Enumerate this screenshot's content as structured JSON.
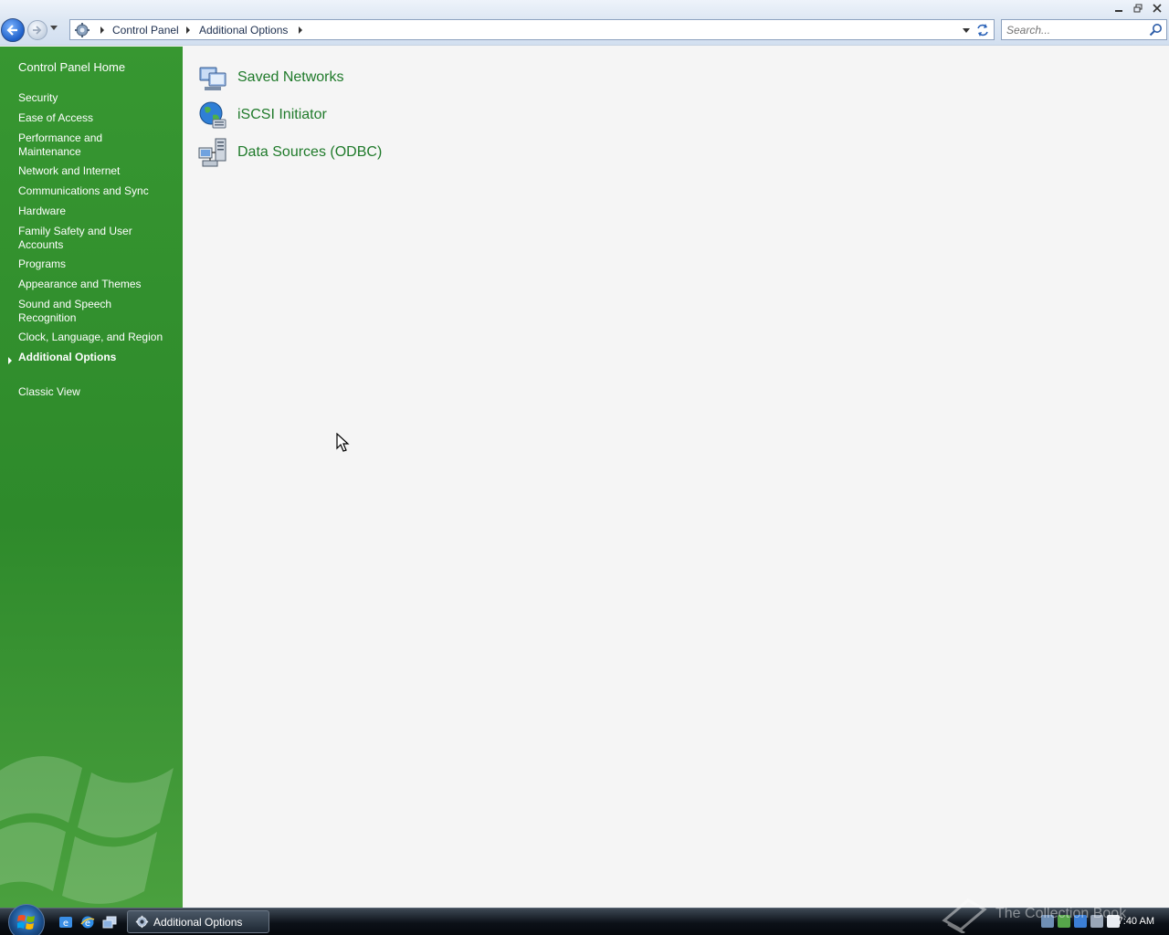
{
  "titlebar": {
    "breadcrumb": [
      "Control Panel",
      "Additional Options"
    ],
    "search_placeholder": "Search..."
  },
  "sidebar": {
    "home": "Control Panel Home",
    "items": [
      "Security",
      "Ease of Access",
      "Performance and Maintenance",
      "Network and Internet",
      "Communications and Sync",
      "Hardware",
      "Family Safety and User Accounts",
      "Programs",
      "Appearance and Themes",
      "Sound and Speech Recognition",
      "Clock, Language, and Region",
      "Additional Options"
    ],
    "current": "Additional Options",
    "classic_view": "Classic View",
    "accent": "#2e8a2b"
  },
  "main": {
    "tasks": [
      {
        "label": "Saved Networks",
        "icon": "saved-networks-icon"
      },
      {
        "label": "iSCSI Initiator",
        "icon": "iscsi-globe-icon"
      },
      {
        "label": "Data Sources (ODBC)",
        "icon": "odbc-data-sources-icon"
      }
    ],
    "link_color": "#1f7a2a"
  },
  "taskbar": {
    "active_window": "Additional Options",
    "clock": "7:40 AM",
    "watermark": "The Collection Book"
  }
}
